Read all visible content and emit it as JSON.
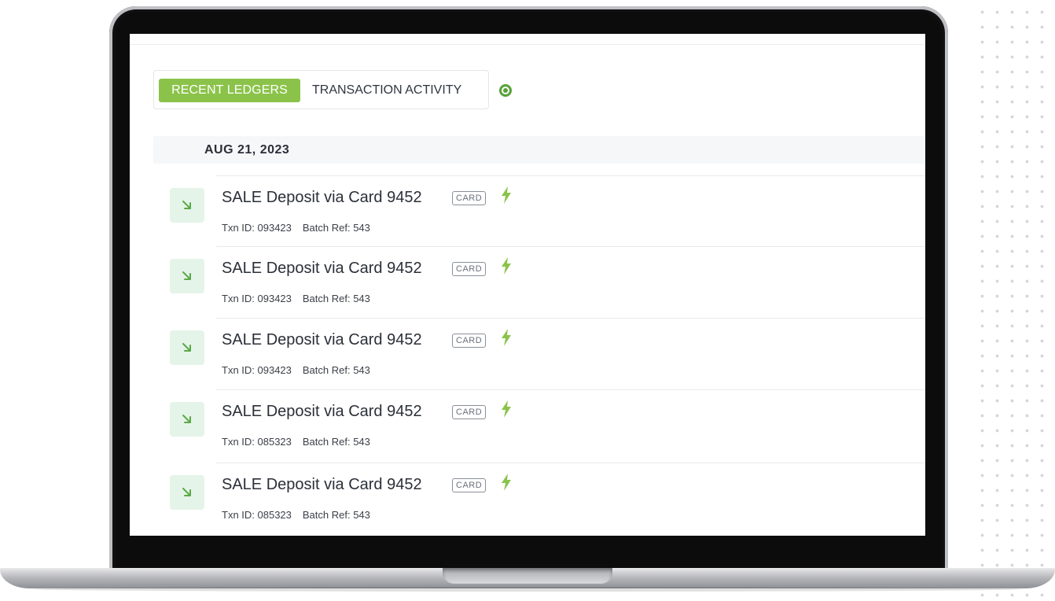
{
  "tabs": {
    "active": "RECENT LEDGERS",
    "secondary": "TRANSACTION ACTIVITY"
  },
  "date_group": "AUG 21, 2023",
  "colors": {
    "accent_green": "#8bc34a",
    "status_green": "#58a13a",
    "arrow_bg": "#e5f4e8"
  },
  "icons": {
    "arrow": "arrow-down-right-icon",
    "bolt": "lightning-bolt-icon"
  },
  "transactions": [
    {
      "title": "SALE Deposit via Card 9452",
      "badge": "CARD",
      "txn": "Txn ID: 093423",
      "batch": "Batch Ref: 543"
    },
    {
      "title": "SALE Deposit via Card 9452",
      "badge": "CARD",
      "txn": "Txn ID: 093423",
      "batch": "Batch Ref: 543"
    },
    {
      "title": "SALE Deposit via Card 9452",
      "badge": "CARD",
      "txn": "Txn ID: 093423",
      "batch": "Batch Ref: 543"
    },
    {
      "title": "SALE Deposit via Card 9452",
      "badge": "CARD",
      "txn": "Txn ID: 085323",
      "batch": "Batch Ref: 543"
    },
    {
      "title": "SALE Deposit via Card 9452",
      "badge": "CARD",
      "txn": "Txn ID: 085323",
      "batch": "Batch Ref: 543"
    }
  ]
}
